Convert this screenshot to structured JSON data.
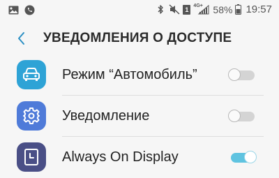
{
  "status_bar": {
    "left_icons": [
      "gallery-icon",
      "phone-icon"
    ],
    "right_icons": [
      "bluetooth-icon",
      "mute-icon",
      "sim-icon",
      "signal-icon",
      "battery-icon"
    ],
    "sim_label": "1",
    "network_label": "4G+",
    "battery_text": "58%",
    "time": "19:57"
  },
  "header": {
    "title": "УВЕДОМЛЕНИЯ О ДОСТУПЕ"
  },
  "list": [
    {
      "label": "Режим “Автомобиль”",
      "icon": "car-icon",
      "icon_bg": "#2ea3d6",
      "enabled": false
    },
    {
      "label": "Уведомление",
      "icon": "gear-icon",
      "icon_bg": "#4f7bd9",
      "enabled": false
    },
    {
      "label": "Always On Display",
      "icon": "aod-icon",
      "icon_bg": "#4a4f86",
      "enabled": true
    }
  ],
  "colors": {
    "accent": "#5fc3e0",
    "background": "#f6f6f6"
  }
}
